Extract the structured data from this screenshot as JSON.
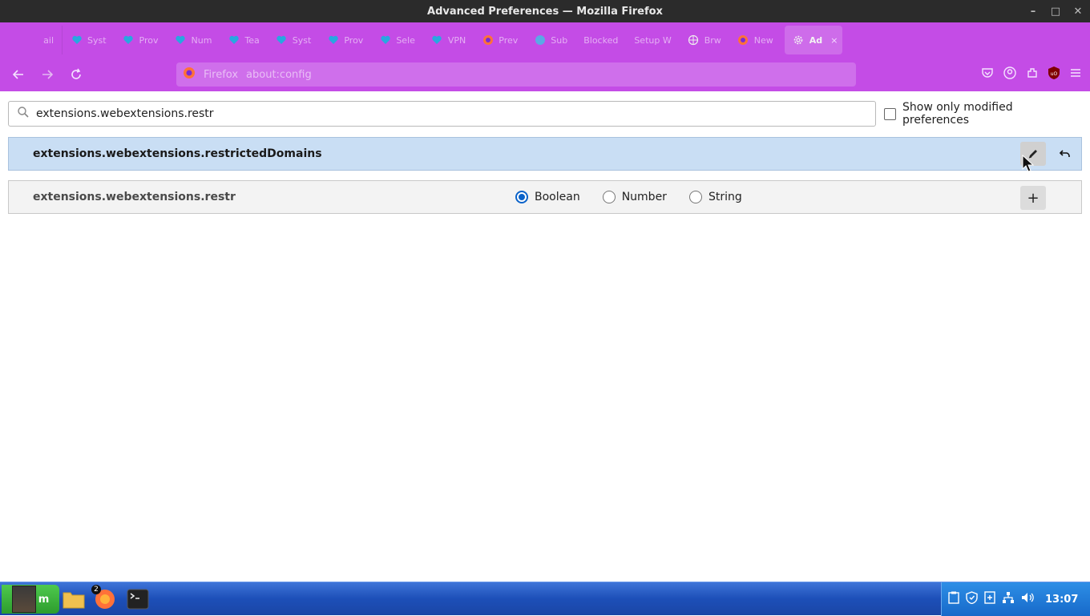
{
  "window": {
    "title": "Advanced Preferences — Mozilla Firefox"
  },
  "tabs": [
    {
      "label": "ail",
      "icon": "none"
    },
    {
      "label": "Syst",
      "icon": "heart-icon"
    },
    {
      "label": "Prov",
      "icon": "heart-icon"
    },
    {
      "label": "Num",
      "icon": "heart-icon"
    },
    {
      "label": "Tea",
      "icon": "heart-icon"
    },
    {
      "label": "Syst",
      "icon": "heart-icon"
    },
    {
      "label": "Prov",
      "icon": "heart-icon"
    },
    {
      "label": "Sele",
      "icon": "heart-icon"
    },
    {
      "label": "VPN",
      "icon": "heart-icon"
    },
    {
      "label": "Prev",
      "icon": "firefox-icon"
    },
    {
      "label": "Sub",
      "icon": "globe-icon"
    },
    {
      "label": "Blocked",
      "icon": "none"
    },
    {
      "label": "Setup W",
      "icon": "none"
    },
    {
      "label": "Brw",
      "icon": "globe-icon"
    },
    {
      "label": "New",
      "icon": "firefox-icon"
    }
  ],
  "active_tab": {
    "label": "Ad",
    "close": "×"
  },
  "urlbar": {
    "prefix": "Firefox",
    "text": "about:config"
  },
  "search": {
    "value": "extensions.webextensions.restr"
  },
  "modified_filter": {
    "label": "Show only modified preferences",
    "checked": false
  },
  "prefs": [
    {
      "name": "extensions.webextensions.restrictedDomains"
    }
  ],
  "new_pref": {
    "name": "extensions.webextensions.restr",
    "types": [
      "Boolean",
      "Number",
      "String"
    ],
    "selected": "Boolean",
    "add": "+"
  },
  "taskbar": {
    "app_badge": "2",
    "start_label": "m",
    "clock": "13:07"
  }
}
